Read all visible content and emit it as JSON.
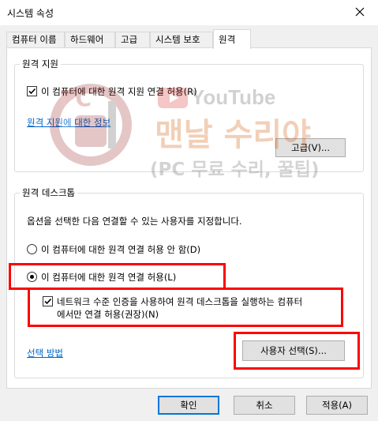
{
  "window": {
    "title": "시스템 속성"
  },
  "tabs": [
    {
      "label": "컴퓨터 이름"
    },
    {
      "label": "하드웨어"
    },
    {
      "label": "고급"
    },
    {
      "label": "시스템 보호"
    },
    {
      "label": "원격"
    }
  ],
  "active_tab": "원격",
  "remote_assistance": {
    "group_label": "원격 지원",
    "allow_checkbox_label": "이 컴퓨터에 대한 원격 지원 연결 허용(R)",
    "allow_checked": true,
    "info_link": "원격 지원에 대한 정보",
    "advanced_button": "고급(V)..."
  },
  "remote_desktop": {
    "group_label": "원격 데스크톱",
    "instruction": "옵션을 선택한 다음 연결할 수 있는 사용자를 지정합니다.",
    "option_deny": "이 컴퓨터에 대한 원격 연결 허용 안 함(D)",
    "option_allow": "이 컴퓨터에 대한 원격 연결 허용(L)",
    "selected_option": "allow",
    "nla_label_line1": "네트워크 수준 인증을 사용하여 원격 데스크톱을 실행하는 컴퓨터",
    "nla_label_line2": "에서만 연결 허용(권장)(N)",
    "nla_checked": true,
    "help_link": "선택 방법",
    "select_users_button": "사용자 선택(S)..."
  },
  "footer": {
    "ok": "확인",
    "cancel": "취소",
    "apply": "적용(A)"
  },
  "watermark": {
    "logo_text": "PC",
    "youtube_text": "YouTube",
    "channel_name": "맨날 수리야",
    "tagline": "(PC 무료 수리, 꿀팁)"
  },
  "colors": {
    "highlight": "#ff0000",
    "link": "#0066cc",
    "accent": "#0078d7"
  }
}
